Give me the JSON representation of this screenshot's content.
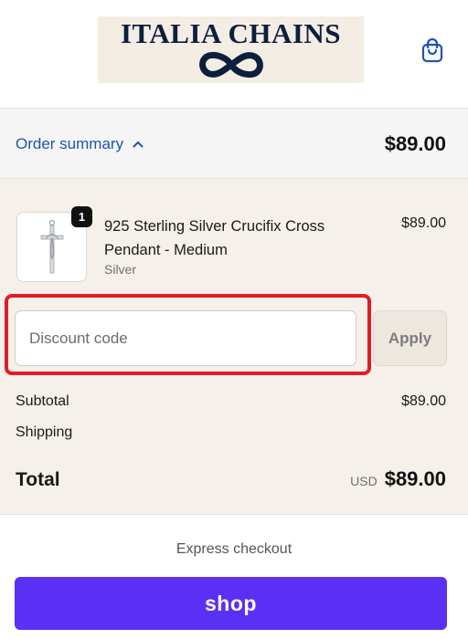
{
  "header": {
    "logo_text": "ITALIA CHAINS",
    "logo_icon": "infinity-icon",
    "cart_icon": "shopping-bag-icon"
  },
  "summary": {
    "toggle_label": "Order summary",
    "total": "$89.00"
  },
  "product": {
    "quantity": "1",
    "name": "925 Sterling Silver Crucifix Cross Pendant - Medium",
    "variant": "Silver",
    "price": "$89.00",
    "image_icon": "crucifix-pendant-icon"
  },
  "discount": {
    "placeholder": "Discount code",
    "value": "",
    "apply_label": "Apply"
  },
  "totals": {
    "subtotal_label": "Subtotal",
    "subtotal_value": "$89.00",
    "shipping_label": "Shipping",
    "total_label": "Total",
    "currency": "USD",
    "total_value": "$89.00"
  },
  "express": {
    "label": "Express checkout",
    "shop_label": "shop"
  },
  "colors": {
    "link": "#1b55b0",
    "shop_pay": "#5a31f4",
    "highlight": "#e01d24",
    "logo_bg": "#f4ede4",
    "logo_text": "#0c1f3d"
  }
}
